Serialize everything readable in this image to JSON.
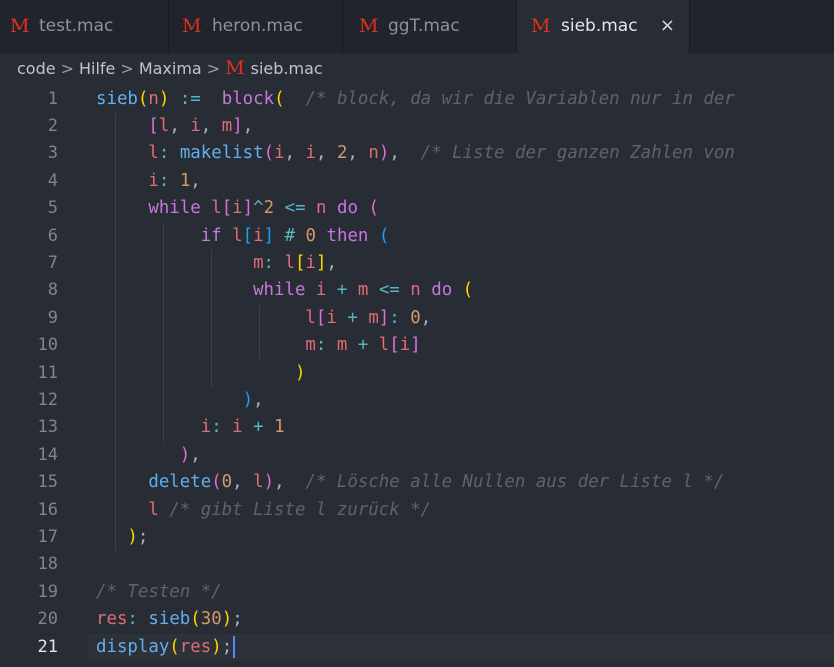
{
  "tabs": [
    {
      "icon": "M",
      "label": "test.mac",
      "active": false
    },
    {
      "icon": "M",
      "label": "heron.mac",
      "active": false
    },
    {
      "icon": "M",
      "label": "ggT.mac",
      "active": false
    },
    {
      "icon": "M",
      "label": "sieb.mac",
      "active": true,
      "close": "×"
    }
  ],
  "breadcrumb": {
    "items": [
      "code",
      "Hilfe",
      "Maxima"
    ],
    "separator": ">",
    "file_icon": "M",
    "file": "sieb.mac"
  },
  "editor": {
    "current_line": 21,
    "lines": [
      [
        [
          "fn",
          "sieb"
        ],
        [
          "p1",
          "("
        ],
        [
          "var",
          "n"
        ],
        [
          "p1",
          ")"
        ],
        [
          "pl",
          " "
        ],
        [
          "op",
          ":="
        ],
        [
          "pl",
          "  "
        ],
        [
          "kw",
          "block"
        ],
        [
          "p1",
          "("
        ],
        [
          "pl",
          "  "
        ],
        [
          "cm",
          "/* block, da wir die Variablen nur in der"
        ]
      ],
      [
        [
          "pl",
          "     "
        ],
        [
          "p2",
          "["
        ],
        [
          "var",
          "l"
        ],
        [
          "pl",
          ", "
        ],
        [
          "var",
          "i"
        ],
        [
          "pl",
          ", "
        ],
        [
          "var",
          "m"
        ],
        [
          "p2",
          "]"
        ],
        [
          "pl",
          ","
        ]
      ],
      [
        [
          "pl",
          "     "
        ],
        [
          "var",
          "l"
        ],
        [
          "op",
          ":"
        ],
        [
          "pl",
          " "
        ],
        [
          "fn",
          "makelist"
        ],
        [
          "p2",
          "("
        ],
        [
          "var",
          "i"
        ],
        [
          "pl",
          ", "
        ],
        [
          "var",
          "i"
        ],
        [
          "pl",
          ", "
        ],
        [
          "num",
          "2"
        ],
        [
          "pl",
          ", "
        ],
        [
          "var",
          "n"
        ],
        [
          "p2",
          ")"
        ],
        [
          "pl",
          ",  "
        ],
        [
          "cm",
          "/* Liste der ganzen Zahlen von"
        ]
      ],
      [
        [
          "pl",
          "     "
        ],
        [
          "var",
          "i"
        ],
        [
          "op",
          ":"
        ],
        [
          "pl",
          " "
        ],
        [
          "num",
          "1"
        ],
        [
          "pl",
          ","
        ]
      ],
      [
        [
          "pl",
          "     "
        ],
        [
          "kw",
          "while"
        ],
        [
          "pl",
          " "
        ],
        [
          "var",
          "l"
        ],
        [
          "p2",
          "["
        ],
        [
          "var",
          "i"
        ],
        [
          "p2",
          "]"
        ],
        [
          "op",
          "^"
        ],
        [
          "num",
          "2"
        ],
        [
          "pl",
          " "
        ],
        [
          "op",
          "<="
        ],
        [
          "pl",
          " "
        ],
        [
          "var",
          "n"
        ],
        [
          "pl",
          " "
        ],
        [
          "kw",
          "do"
        ],
        [
          "pl",
          " "
        ],
        [
          "p2",
          "("
        ]
      ],
      [
        [
          "pl",
          "          "
        ],
        [
          "kw",
          "if"
        ],
        [
          "pl",
          " "
        ],
        [
          "var",
          "l"
        ],
        [
          "p3",
          "["
        ],
        [
          "var",
          "i"
        ],
        [
          "p3",
          "]"
        ],
        [
          "pl",
          " "
        ],
        [
          "op",
          "#"
        ],
        [
          "pl",
          " "
        ],
        [
          "num",
          "0"
        ],
        [
          "pl",
          " "
        ],
        [
          "kw",
          "then"
        ],
        [
          "pl",
          " "
        ],
        [
          "p3",
          "("
        ]
      ],
      [
        [
          "pl",
          "               "
        ],
        [
          "var",
          "m"
        ],
        [
          "op",
          ":"
        ],
        [
          "pl",
          " "
        ],
        [
          "var",
          "l"
        ],
        [
          "p1",
          "["
        ],
        [
          "var",
          "i"
        ],
        [
          "p1",
          "]"
        ],
        [
          "pl",
          ","
        ]
      ],
      [
        [
          "pl",
          "               "
        ],
        [
          "kw",
          "while"
        ],
        [
          "pl",
          " "
        ],
        [
          "var",
          "i"
        ],
        [
          "pl",
          " "
        ],
        [
          "op",
          "+"
        ],
        [
          "pl",
          " "
        ],
        [
          "var",
          "m"
        ],
        [
          "pl",
          " "
        ],
        [
          "op",
          "<="
        ],
        [
          "pl",
          " "
        ],
        [
          "var",
          "n"
        ],
        [
          "pl",
          " "
        ],
        [
          "kw",
          "do"
        ],
        [
          "pl",
          " "
        ],
        [
          "p1",
          "("
        ]
      ],
      [
        [
          "pl",
          "                    "
        ],
        [
          "var",
          "l"
        ],
        [
          "p2",
          "["
        ],
        [
          "var",
          "i"
        ],
        [
          "pl",
          " "
        ],
        [
          "op",
          "+"
        ],
        [
          "pl",
          " "
        ],
        [
          "var",
          "m"
        ],
        [
          "p2",
          "]"
        ],
        [
          "op",
          ":"
        ],
        [
          "pl",
          " "
        ],
        [
          "num",
          "0"
        ],
        [
          "pl",
          ","
        ]
      ],
      [
        [
          "pl",
          "                    "
        ],
        [
          "var",
          "m"
        ],
        [
          "op",
          ":"
        ],
        [
          "pl",
          " "
        ],
        [
          "var",
          "m"
        ],
        [
          "pl",
          " "
        ],
        [
          "op",
          "+"
        ],
        [
          "pl",
          " "
        ],
        [
          "var",
          "l"
        ],
        [
          "p2",
          "["
        ],
        [
          "var",
          "i"
        ],
        [
          "p2",
          "]"
        ]
      ],
      [
        [
          "pl",
          "                   "
        ],
        [
          "p1",
          ")"
        ]
      ],
      [
        [
          "pl",
          "              "
        ],
        [
          "p3",
          ")"
        ],
        [
          "pl",
          ","
        ]
      ],
      [
        [
          "pl",
          "          "
        ],
        [
          "var",
          "i"
        ],
        [
          "op",
          ":"
        ],
        [
          "pl",
          " "
        ],
        [
          "var",
          "i"
        ],
        [
          "pl",
          " "
        ],
        [
          "op",
          "+"
        ],
        [
          "pl",
          " "
        ],
        [
          "num",
          "1"
        ]
      ],
      [
        [
          "pl",
          "        "
        ],
        [
          "p2",
          ")"
        ],
        [
          "pl",
          ","
        ]
      ],
      [
        [
          "pl",
          "     "
        ],
        [
          "fn",
          "delete"
        ],
        [
          "p2",
          "("
        ],
        [
          "num",
          "0"
        ],
        [
          "pl",
          ", "
        ],
        [
          "var",
          "l"
        ],
        [
          "p2",
          ")"
        ],
        [
          "pl",
          ",  "
        ],
        [
          "cm",
          "/* Lösche alle Nullen aus der Liste l */"
        ]
      ],
      [
        [
          "pl",
          "     "
        ],
        [
          "var",
          "l"
        ],
        [
          "pl",
          " "
        ],
        [
          "cm",
          "/* gibt Liste l zurück */"
        ]
      ],
      [
        [
          "pl",
          "   "
        ],
        [
          "p1",
          ")"
        ],
        [
          "pl",
          ";"
        ]
      ],
      [],
      [
        [
          "cm",
          "/* Testen */"
        ]
      ],
      [
        [
          "var",
          "res"
        ],
        [
          "op",
          ":"
        ],
        [
          "pl",
          " "
        ],
        [
          "fn",
          "sieb"
        ],
        [
          "p1",
          "("
        ],
        [
          "num",
          "30"
        ],
        [
          "p1",
          ")"
        ],
        [
          "pl",
          ";"
        ]
      ],
      [
        [
          "fn",
          "display"
        ],
        [
          "p1",
          "("
        ],
        [
          "var",
          "res"
        ],
        [
          "p1",
          ")"
        ],
        [
          "pl",
          ";"
        ]
      ]
    ]
  }
}
